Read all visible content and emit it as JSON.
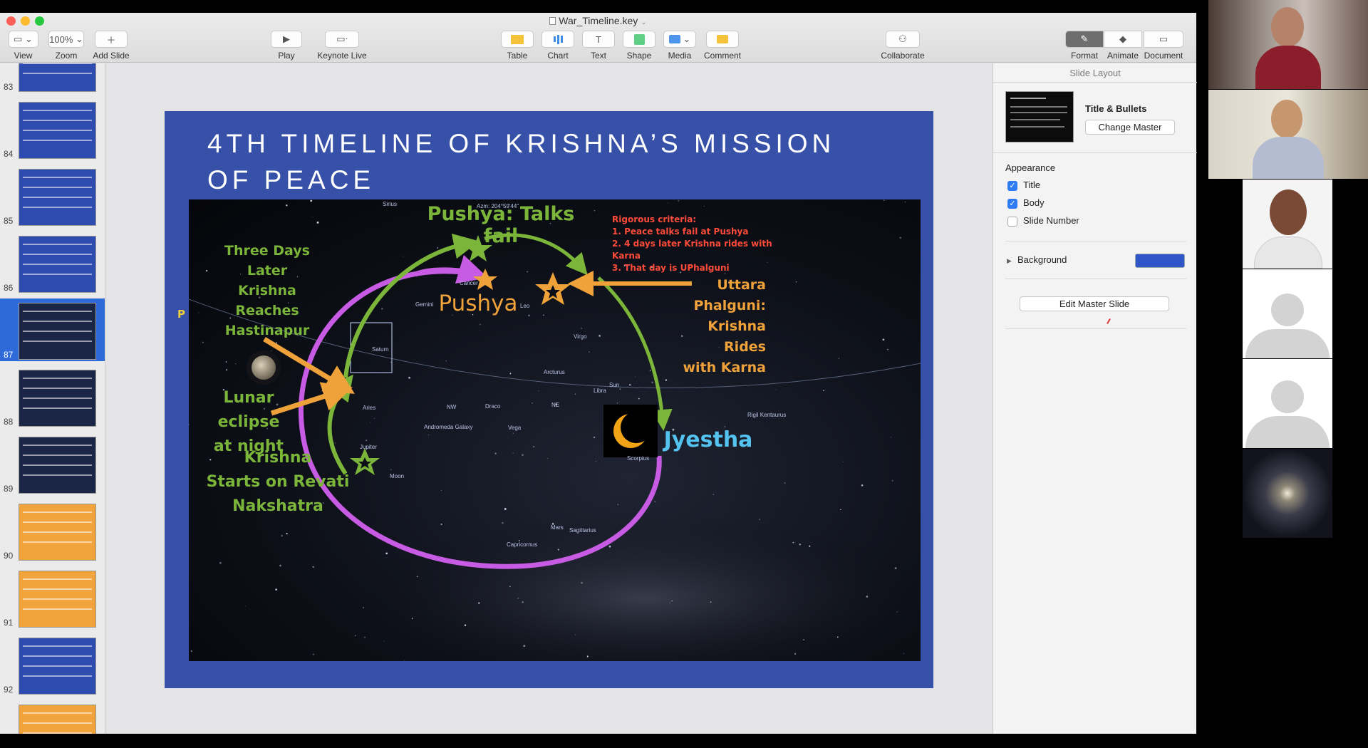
{
  "window": {
    "title": "War_Timeline.key"
  },
  "toolbar": {
    "view": "View",
    "zoom_value": "100%",
    "zoom": "Zoom",
    "add_slide": "Add Slide",
    "play": "Play",
    "keynote_live": "Keynote Live",
    "table": "Table",
    "chart": "Chart",
    "text": "Text",
    "shape": "Shape",
    "media": "Media",
    "comment": "Comment",
    "collaborate": "Collaborate",
    "format": "Format",
    "animate": "Animate",
    "document": "Document"
  },
  "navigator": {
    "slides": [
      {
        "number": "83",
        "bg": "#2e4bb0"
      },
      {
        "number": "84",
        "bg": "#2e4bb0"
      },
      {
        "number": "85",
        "bg": "#2e4bb0"
      },
      {
        "number": "86",
        "bg": "#2e4bb0"
      },
      {
        "number": "87",
        "bg": "#1b2545",
        "selected": true
      },
      {
        "number": "88",
        "bg": "#1b2545"
      },
      {
        "number": "89",
        "bg": "#1b2545"
      },
      {
        "number": "90",
        "bg": "#f2a43c"
      },
      {
        "number": "91",
        "bg": "#f2a43c"
      },
      {
        "number": "92",
        "bg": "#2e4bb0"
      },
      {
        "number": "",
        "bg": "#f2a43c"
      }
    ]
  },
  "slide": {
    "title": "4TH TIMELINE OF KRISHNA’S MISSION OF PEACE",
    "talks_fail": "Pushya: Talks fail",
    "criteria_heading": "Rigorous criteria:",
    "criteria": [
      "1.  Peace talks fail at Pushya",
      "2. 4 days later Krishna rides with Karna",
      "3. That day is UPhalguni"
    ],
    "three_days": [
      "Three Days",
      "Later",
      "Krishna",
      "Reaches",
      "Hastinapur"
    ],
    "pushya": "Pushya",
    "uttara": [
      "Uttara",
      "Phalguni:",
      "Krishna",
      "Rides",
      "with Karna"
    ],
    "lunar_eclipse": [
      "Lunar eclipse",
      "at night"
    ],
    "krishna_starts": [
      "Krishna",
      "Starts on Revati",
      "Nakshatra"
    ],
    "jyestha": "Jyestha",
    "sky_labels": {
      "azm": "Azm: 204°59'44\"",
      "sirius": "Sirius",
      "cancer": "Cancer",
      "gemini": "Gemini",
      "leo": "Leo",
      "virgo": "Virgo",
      "arcturus": "Arcturus",
      "saturn": "Saturn",
      "libra": "Libra",
      "sun": "Sun",
      "aries": "Aries",
      "draco": "Draco",
      "andromeda": "Andromeda Galaxy",
      "vega": "Vega",
      "jupiter": "Jupiter",
      "moon": "Moon",
      "scorpius": "Scorpius",
      "mars": "Mars",
      "sagittarius": "Sagittarius",
      "capricornus": "Capricornus",
      "rigil": "Rigil Kentaurus",
      "nw": "NW",
      "ne": "NE"
    },
    "side_letter": "P"
  },
  "inspector": {
    "header": "Slide Layout",
    "layout_name": "Title & Bullets",
    "change_master": "Change Master",
    "appearance": "Appearance",
    "title_option": "Title",
    "body_option": "Body",
    "slide_number_option": "Slide Number",
    "background": "Background",
    "background_color": "#2f55c9",
    "edit_master": "Edit Master Slide"
  },
  "colors": {
    "green": "#7bb53a",
    "orange": "#f0a23a",
    "purple": "#c75be3",
    "cyan": "#55c3f0",
    "red": "#ff4b3a",
    "slide_blue": "#3750a8"
  }
}
